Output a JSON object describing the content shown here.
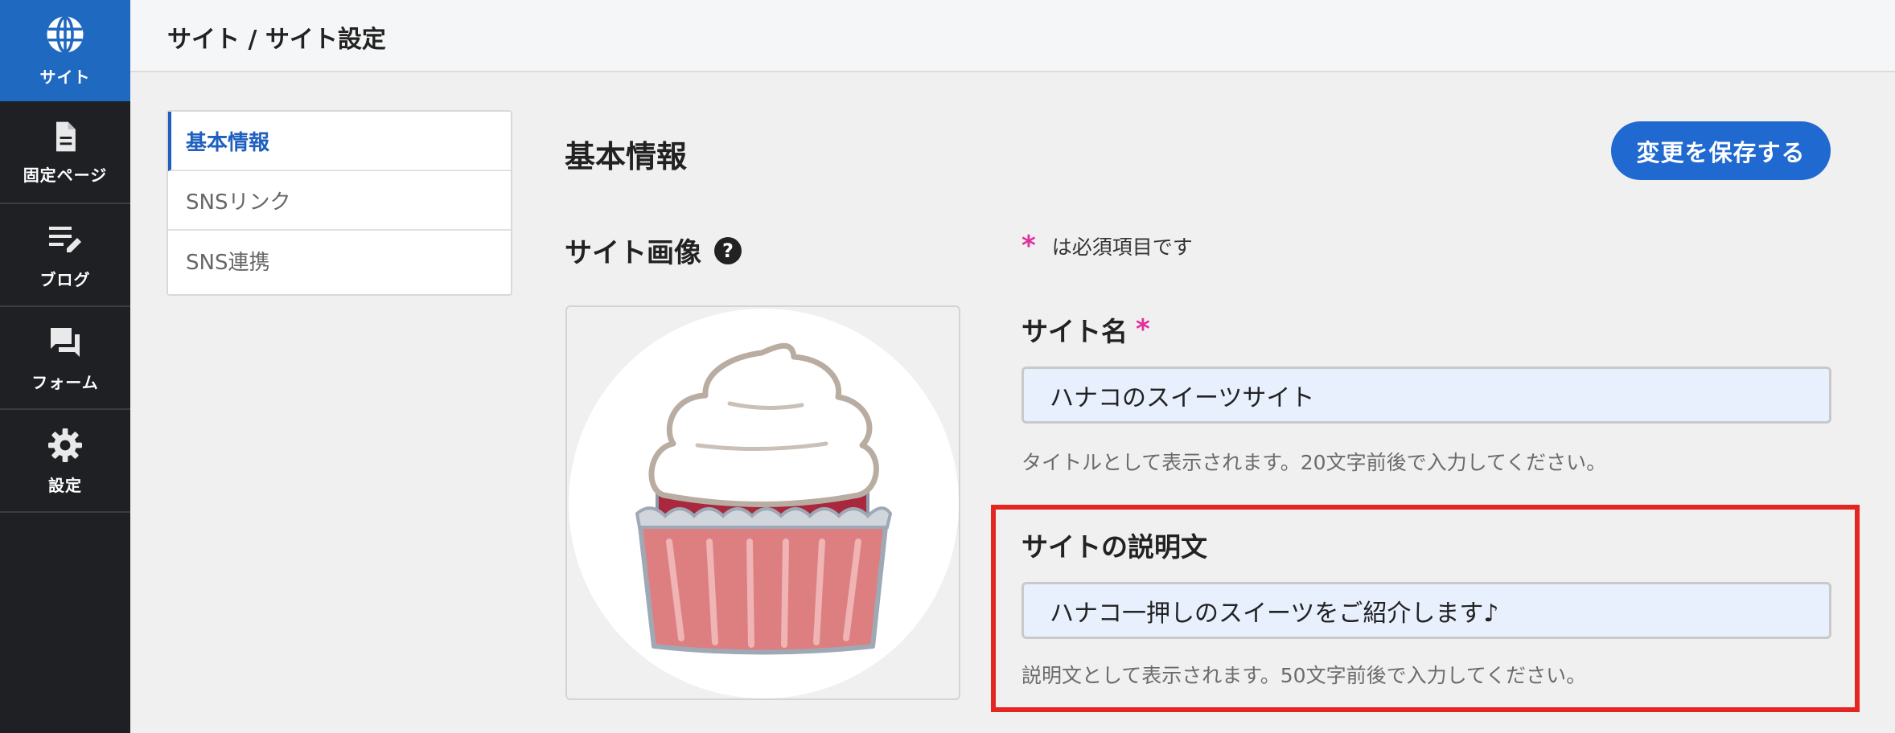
{
  "nav": {
    "items": [
      {
        "label": "サイト",
        "icon": "globe-icon",
        "active": true
      },
      {
        "label": "固定ページ",
        "icon": "document-icon",
        "active": false
      },
      {
        "label": "ブログ",
        "icon": "edit-list-icon",
        "active": false
      },
      {
        "label": "フォーム",
        "icon": "chat-icon",
        "active": false
      },
      {
        "label": "設定",
        "icon": "gear-icon",
        "active": false
      }
    ]
  },
  "header": {
    "breadcrumb": "サイト / サイト設定"
  },
  "submenu": {
    "items": [
      {
        "label": "基本情報",
        "active": true
      },
      {
        "label": "SNSリンク",
        "active": false
      },
      {
        "label": "SNS連携",
        "active": false
      }
    ]
  },
  "main": {
    "title": "基本情報",
    "save_label": "変更を保存する",
    "image_label": "サイト画像",
    "help_glyph": "?",
    "required_marker": "*",
    "required_note": "は必須項目です",
    "site_name": {
      "label": "サイト名",
      "value": "ハナコのスイーツサイト",
      "hint": "タイトルとして表示されます。20文字前後で入力してください。"
    },
    "site_description": {
      "label": "サイトの説明文",
      "value": "ハナコ一押しのスイーツをご紹介します♪",
      "hint": "説明文として表示されます。50文字前後で入力してください。"
    }
  },
  "colors": {
    "accent": "#1f69d1",
    "nav_bg": "#1e2024",
    "required": "#e0319c",
    "highlight": "#e5251f"
  }
}
